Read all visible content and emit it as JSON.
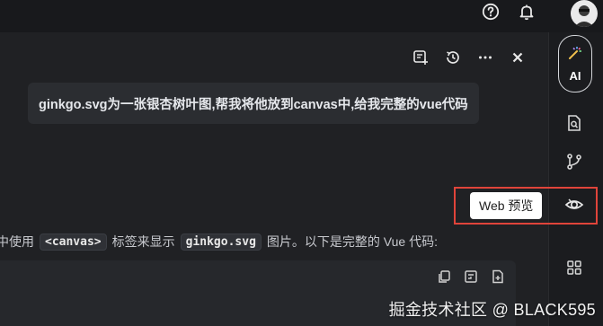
{
  "user_message": "ginkgo.svg为一张银杏树叶图,帮我将他放到canvas中,给我完整的vue代码",
  "answer": {
    "part1": "中使用",
    "chip1": "<canvas>",
    "part2": "标签来显示",
    "chip2": "ginkgo.svg",
    "part3": "图片。以下是完整的 Vue 代码:"
  },
  "rail": {
    "ai_label": "AI",
    "tooltip": "Web 预览"
  },
  "watermark": "掘金技术社区 @ BLACK595",
  "icons": {
    "top": [
      "help-icon",
      "bell-icon"
    ],
    "panel_toolbar": [
      "new-chat-icon",
      "history-icon",
      "more-icon",
      "close-icon"
    ],
    "code_toolbar": [
      "copy-icon",
      "insert-icon",
      "new-file-icon"
    ],
    "rail": [
      "sparkle-icon",
      "search-doc-icon",
      "branch-icon",
      "eye-icon",
      "apps-icon"
    ]
  },
  "colors": {
    "background": "#1e1f22",
    "highlight": "#e0443a",
    "tooltip_bg": "#ffffff"
  }
}
